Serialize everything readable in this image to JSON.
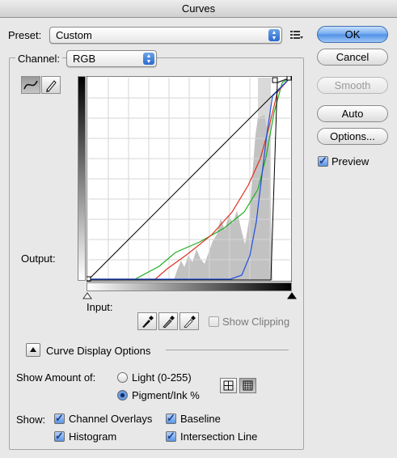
{
  "window": {
    "title": "Curves"
  },
  "preset": {
    "label": "Preset:",
    "value": "Custom"
  },
  "channel": {
    "label": "Channel:",
    "value": "RGB"
  },
  "buttons": {
    "ok": "OK",
    "cancel": "Cancel",
    "smooth": "Smooth",
    "auto": "Auto",
    "options": "Options..."
  },
  "preview": {
    "label": "Preview",
    "checked": true
  },
  "graph": {
    "output_label": "Output:",
    "input_label": "Input:",
    "show_clipping_label": "Show Clipping",
    "curve_colors": {
      "composite": "#000000",
      "red": "#e0301e",
      "green": "#1fae1f",
      "blue": "#1f4fe0"
    }
  },
  "display_options": {
    "disclosure_label": "Curve Display Options",
    "show_amount_label": "Show Amount of:",
    "light_option": "Light  (0-255)",
    "pigment_option": "Pigment/Ink %",
    "selected_amount": "pigment",
    "show_label": "Show:",
    "checkboxes": {
      "channel_overlays": "Channel Overlays",
      "baseline": "Baseline",
      "histogram": "Histogram",
      "intersection_line": "Intersection Line"
    }
  }
}
